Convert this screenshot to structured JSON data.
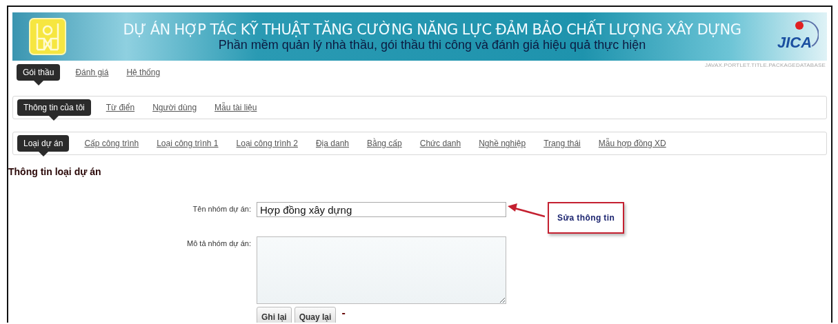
{
  "header": {
    "title": "DỰ ÁN HỢP TÁC KỸ THUẬT TĂNG CƯỜNG NĂNG LỰC ĐẢM BẢO CHẤT LƯỢNG XÂY DỰNG",
    "subtitle": "Phần mềm quản lý nhà thầu, gói thầu thi công và đánh giá hiệu quả thực hiện",
    "partner_logo": "JICA",
    "portlet_title": "JAVAX.PORTLET.TITLE.PACKAGEDATABASE"
  },
  "menus": [
    {
      "items": [
        {
          "label": "Gói thầu",
          "selected": true
        },
        {
          "label": "Đánh giá",
          "selected": false
        },
        {
          "label": "Hệ thống",
          "selected": false
        }
      ]
    },
    {
      "items": [
        {
          "label": "Thông tin của tôi",
          "selected": true
        },
        {
          "label": "Từ điển",
          "selected": false
        },
        {
          "label": "Người dùng",
          "selected": false
        },
        {
          "label": "Mẫu tài liệu",
          "selected": false
        }
      ]
    },
    {
      "items": [
        {
          "label": "Loại dự án",
          "selected": true
        },
        {
          "label": "Cấp công trình",
          "selected": false
        },
        {
          "label": "Loại công trình 1",
          "selected": false
        },
        {
          "label": "Loại công trình 2",
          "selected": false
        },
        {
          "label": "Địa danh",
          "selected": false
        },
        {
          "label": "Bằng cấp",
          "selected": false
        },
        {
          "label": "Chức danh",
          "selected": false
        },
        {
          "label": "Nghề nghiệp",
          "selected": false
        },
        {
          "label": "Trạng thái",
          "selected": false
        },
        {
          "label": "Mẫu hợp đồng XD",
          "selected": false
        }
      ]
    }
  ],
  "form": {
    "heading": "Thông tin loại dự án",
    "name_label": "Tên nhóm dự án:",
    "name_value": "Hợp đồng xây dựng",
    "description_label": "Mô tả nhóm dự án:",
    "buttons": [
      "Ghi lại",
      "Quay lại"
    ],
    "trailing_mark": "-"
  },
  "callout": {
    "text": "Sửa thông tin"
  }
}
